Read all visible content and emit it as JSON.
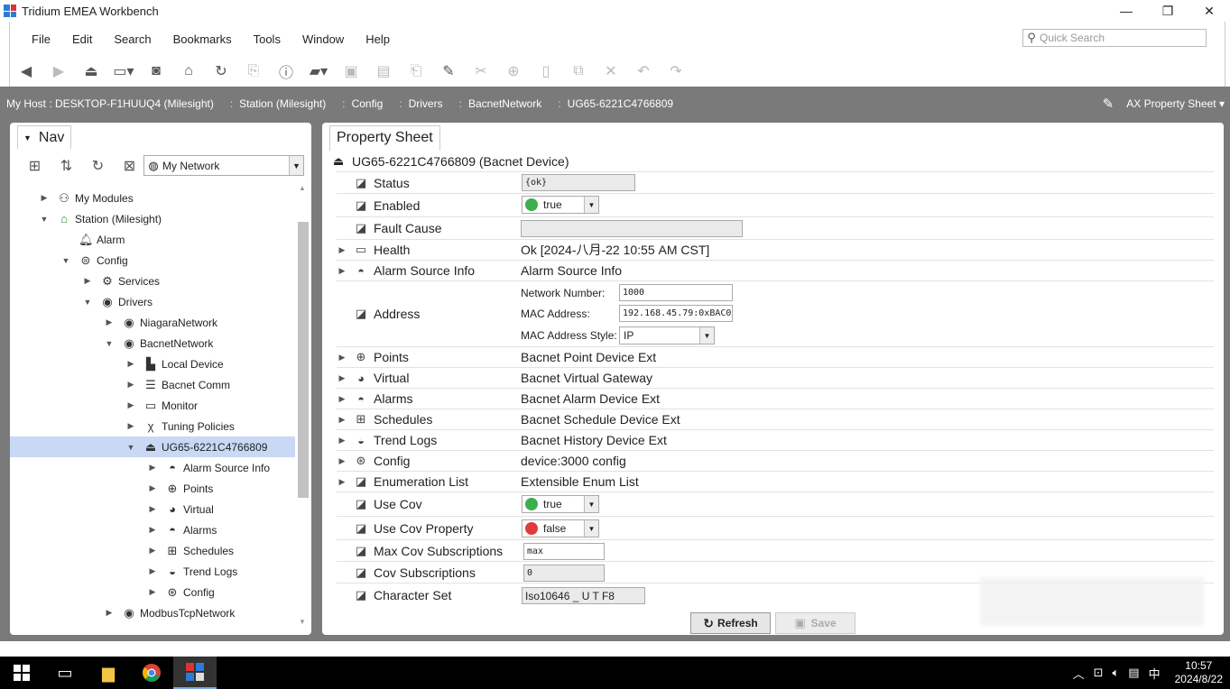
{
  "window": {
    "title": "Tridium EMEA Workbench",
    "min": "—",
    "max": "❐",
    "close": "✕"
  },
  "menu": [
    "File",
    "Edit",
    "Search",
    "Bookmarks",
    "Tools",
    "Window",
    "Help"
  ],
  "quick_search": {
    "placeholder": "Quick Search"
  },
  "toolbar_icons": [
    "back-icon",
    "forward-icon",
    "up-level-icon",
    "sidebar-icon",
    "camera-icon",
    "home-icon",
    "refresh-icon",
    "open-icon",
    "info-icon",
    "folder-icon",
    "save-icon",
    "save-all-icon",
    "export-icon",
    "edit-icon",
    "cut-icon",
    "copy-icon",
    "paste-icon",
    "duplicate-icon",
    "delete-icon",
    "undo-icon",
    "redo-icon"
  ],
  "path": {
    "segments": [
      "My Host : DESKTOP-F1HUUQ4 (Milesight)",
      "Station (Milesight)",
      "Config",
      "Drivers",
      "BacnetNetwork",
      "UG65-6221C4766809"
    ],
    "view": "AX Property Sheet"
  },
  "nav": {
    "tab": "Nav",
    "network": "My Network",
    "tree": [
      {
        "label": "My Modules",
        "icon": "modules-icon"
      },
      {
        "label": "Station (Milesight)",
        "icon": "station-icon"
      },
      {
        "label": "Alarm",
        "icon": "bell-icon"
      },
      {
        "label": "Config",
        "icon": "config-icon"
      },
      {
        "label": "Services",
        "icon": "services-icon"
      },
      {
        "label": "Drivers",
        "icon": "drivers-icon"
      },
      {
        "label": "NiagaraNetwork",
        "icon": "network-icon"
      },
      {
        "label": "BacnetNetwork",
        "icon": "network-icon"
      },
      {
        "label": "Local Device",
        "icon": "device-icon"
      },
      {
        "label": "Bacnet Comm",
        "icon": "comm-icon"
      },
      {
        "label": "Monitor",
        "icon": "monitor-icon"
      },
      {
        "label": "Tuning Policies",
        "icon": "tuning-icon"
      },
      {
        "label": "UG65-6221C4766809",
        "icon": "bacnet-device-icon"
      },
      {
        "label": "Alarm Source Info",
        "icon": "alarm-source-icon"
      },
      {
        "label": "Points",
        "icon": "points-icon"
      },
      {
        "label": "Virtual",
        "icon": "virtual-icon"
      },
      {
        "label": "Alarms",
        "icon": "alarms-icon"
      },
      {
        "label": "Schedules",
        "icon": "schedules-icon"
      },
      {
        "label": "Trend Logs",
        "icon": "trend-icon"
      },
      {
        "label": "Config",
        "icon": "config-icon"
      },
      {
        "label": "ModbusTcpNetwork",
        "icon": "network-icon"
      }
    ]
  },
  "sheet": {
    "tab": "Property Sheet",
    "title": "UG65-6221C4766809  (Bacnet Device)",
    "rows": {
      "status": {
        "label": "Status",
        "value": "{ok}"
      },
      "enabled": {
        "label": "Enabled",
        "value": "true"
      },
      "fault_cause": {
        "label": "Fault Cause",
        "value": ""
      },
      "health": {
        "label": "Health",
        "value": "Ok [2024-八月-22 10:55 AM CST]"
      },
      "alarm_source": {
        "label": "Alarm Source Info",
        "value": "Alarm Source Info"
      },
      "address": {
        "label": "Address",
        "network_number_label": "Network Number:",
        "network_number": "1000",
        "mac_label": "MAC Address:",
        "mac": "192.168.45.79:0xBAC0",
        "mac_style_label": "MAC Address Style:",
        "mac_style": "IP"
      },
      "points": {
        "label": "Points",
        "value": "Bacnet Point Device Ext"
      },
      "virtual": {
        "label": "Virtual",
        "value": "Bacnet Virtual Gateway"
      },
      "alarms": {
        "label": "Alarms",
        "value": "Bacnet Alarm Device Ext"
      },
      "schedules": {
        "label": "Schedules",
        "value": "Bacnet Schedule Device Ext"
      },
      "trend_logs": {
        "label": "Trend Logs",
        "value": "Bacnet History Device Ext"
      },
      "config": {
        "label": "Config",
        "value": "device:3000 config"
      },
      "enum_list": {
        "label": "Enumeration List",
        "value": "Extensible Enum List"
      },
      "use_cov": {
        "label": "Use Cov",
        "value": "true"
      },
      "use_cov_property": {
        "label": "Use Cov Property",
        "value": "false"
      },
      "max_cov": {
        "label": "Max Cov Subscriptions",
        "value": "max"
      },
      "cov_subs": {
        "label": "Cov Subscriptions",
        "value": "0"
      },
      "charset": {
        "label": "Character Set",
        "value": "Iso10646 _ U T F8"
      }
    },
    "refresh": "Refresh",
    "save": "Save"
  },
  "taskbar": {
    "time": "10:57",
    "date": "2024/8/22",
    "ime": "中"
  },
  "colors": {
    "true_dot": "#3cae4e",
    "false_dot": "#e03c3c",
    "selection": "#c9d9f5",
    "frame": "#7a7a7a"
  }
}
